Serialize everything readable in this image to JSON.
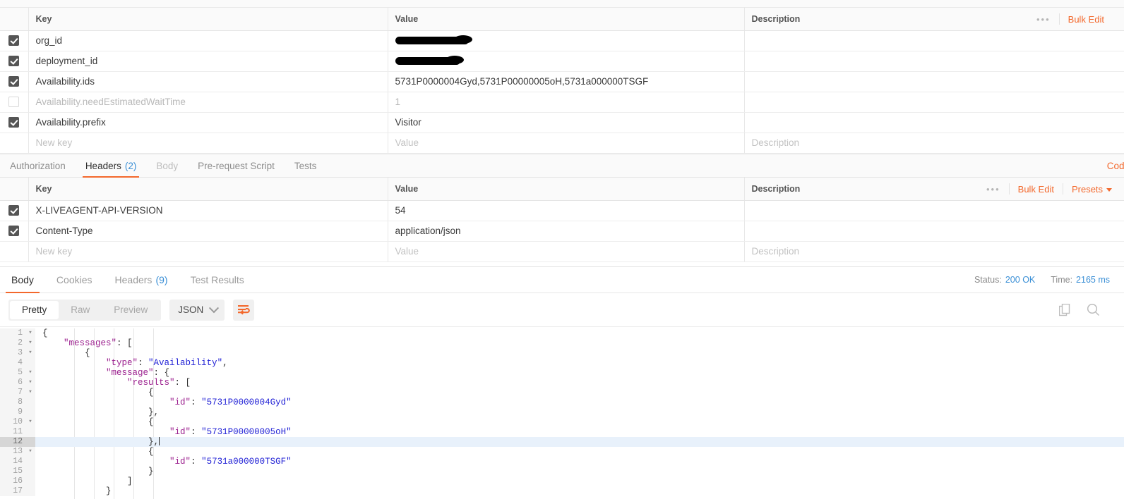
{
  "params_table": {
    "columns": [
      "Key",
      "Value",
      "Description"
    ],
    "actions": {
      "dots": "•••",
      "bulk_edit": "Bulk Edit"
    },
    "rows": [
      {
        "checked": true,
        "key": "org_id",
        "value": "",
        "redacted": true,
        "redact_width": 104,
        "description": ""
      },
      {
        "checked": true,
        "key": "deployment_id",
        "value": "",
        "redacted": true,
        "redact_width": 92,
        "description": ""
      },
      {
        "checked": true,
        "key": "Availability.ids",
        "value": "5731P0000004Gyd,5731P00000005oH,5731a000000TSGF",
        "redacted": false,
        "description": ""
      },
      {
        "checked": false,
        "key": "Availability.needEstimatedWaitTime",
        "value": "1",
        "redacted": false,
        "description": ""
      },
      {
        "checked": true,
        "key": "Availability.prefix",
        "value": "Visitor",
        "redacted": false,
        "description": ""
      }
    ],
    "placeholder_row": {
      "key": "New key",
      "value": "Value",
      "description": "Description"
    }
  },
  "request_tabs": {
    "items": [
      {
        "label": "Authorization",
        "count": "",
        "active": false,
        "muted": false
      },
      {
        "label": "Headers",
        "count": "(2)",
        "active": true,
        "muted": false
      },
      {
        "label": "Body",
        "count": "",
        "active": false,
        "muted": true
      },
      {
        "label": "Pre-request Script",
        "count": "",
        "active": false,
        "muted": false
      },
      {
        "label": "Tests",
        "count": "",
        "active": false,
        "muted": false
      }
    ],
    "code_link": "Code"
  },
  "headers_table": {
    "columns": [
      "Key",
      "Value",
      "Description"
    ],
    "actions": {
      "dots": "•••",
      "bulk_edit": "Bulk Edit",
      "presets": "Presets"
    },
    "rows": [
      {
        "checked": true,
        "key": "X-LIVEAGENT-API-VERSION",
        "value": "54",
        "description": ""
      },
      {
        "checked": true,
        "key": "Content-Type",
        "value": "application/json",
        "description": ""
      }
    ],
    "placeholder_row": {
      "key": "New key",
      "value": "Value",
      "description": "Description"
    }
  },
  "response": {
    "tabs": [
      {
        "label": "Body",
        "count": "",
        "active": true
      },
      {
        "label": "Cookies",
        "count": "",
        "active": false
      },
      {
        "label": "Headers",
        "count": "(9)",
        "active": false
      },
      {
        "label": "Test Results",
        "count": "",
        "active": false
      }
    ],
    "status_label": "Status:",
    "status_value": "200 OK",
    "time_label": "Time:",
    "time_value": "2165 ms",
    "toolbar": {
      "views": [
        {
          "label": "Pretty",
          "selected": true
        },
        {
          "label": "Raw",
          "selected": false
        },
        {
          "label": "Preview",
          "selected": false
        }
      ],
      "format": "JSON",
      "wrap_icon": "word-wrap-icon",
      "copy_icon": "copy-icon",
      "search_icon": "search-icon"
    },
    "body_lines": [
      {
        "n": 1,
        "fold": true,
        "active": false,
        "indent": 0,
        "tokens": [
          {
            "t": "pun",
            "v": "{"
          }
        ]
      },
      {
        "n": 2,
        "fold": true,
        "active": false,
        "indent": 1,
        "tokens": [
          {
            "t": "key",
            "v": "\"messages\""
          },
          {
            "t": "pun",
            "v": ": ["
          }
        ]
      },
      {
        "n": 3,
        "fold": true,
        "active": false,
        "indent": 2,
        "tokens": [
          {
            "t": "pun",
            "v": "{"
          }
        ]
      },
      {
        "n": 4,
        "fold": false,
        "active": false,
        "indent": 3,
        "tokens": [
          {
            "t": "key",
            "v": "\"type\""
          },
          {
            "t": "pun",
            "v": ": "
          },
          {
            "t": "str",
            "v": "\"Availability\""
          },
          {
            "t": "pun",
            "v": ","
          }
        ]
      },
      {
        "n": 5,
        "fold": true,
        "active": false,
        "indent": 3,
        "tokens": [
          {
            "t": "key",
            "v": "\"message\""
          },
          {
            "t": "pun",
            "v": ": {"
          }
        ]
      },
      {
        "n": 6,
        "fold": true,
        "active": false,
        "indent": 4,
        "tokens": [
          {
            "t": "key",
            "v": "\"results\""
          },
          {
            "t": "pun",
            "v": ": ["
          }
        ]
      },
      {
        "n": 7,
        "fold": true,
        "active": false,
        "indent": 5,
        "tokens": [
          {
            "t": "pun",
            "v": "{"
          }
        ]
      },
      {
        "n": 8,
        "fold": false,
        "active": false,
        "indent": 6,
        "tokens": [
          {
            "t": "key",
            "v": "\"id\""
          },
          {
            "t": "pun",
            "v": ": "
          },
          {
            "t": "str",
            "v": "\"5731P0000004Gyd\""
          }
        ]
      },
      {
        "n": 9,
        "fold": false,
        "active": false,
        "indent": 5,
        "tokens": [
          {
            "t": "pun",
            "v": "},"
          }
        ]
      },
      {
        "n": 10,
        "fold": true,
        "active": false,
        "indent": 5,
        "tokens": [
          {
            "t": "pun",
            "v": "{"
          }
        ]
      },
      {
        "n": 11,
        "fold": false,
        "active": false,
        "indent": 6,
        "tokens": [
          {
            "t": "key",
            "v": "\"id\""
          },
          {
            "t": "pun",
            "v": ": "
          },
          {
            "t": "str",
            "v": "\"5731P00000005oH\""
          }
        ]
      },
      {
        "n": 12,
        "fold": false,
        "active": true,
        "indent": 5,
        "tokens": [
          {
            "t": "pun",
            "v": "},"
          }
        ],
        "caret": true
      },
      {
        "n": 13,
        "fold": true,
        "active": false,
        "indent": 5,
        "tokens": [
          {
            "t": "pun",
            "v": "{"
          }
        ]
      },
      {
        "n": 14,
        "fold": false,
        "active": false,
        "indent": 6,
        "tokens": [
          {
            "t": "key",
            "v": "\"id\""
          },
          {
            "t": "pun",
            "v": ": "
          },
          {
            "t": "str",
            "v": "\"5731a000000TSGF\""
          }
        ]
      },
      {
        "n": 15,
        "fold": false,
        "active": false,
        "indent": 5,
        "tokens": [
          {
            "t": "pun",
            "v": "}"
          }
        ]
      },
      {
        "n": 16,
        "fold": false,
        "active": false,
        "indent": 4,
        "tokens": [
          {
            "t": "pun",
            "v": "]"
          }
        ]
      },
      {
        "n": 17,
        "fold": false,
        "active": false,
        "indent": 3,
        "tokens": [
          {
            "t": "pun",
            "v": "}"
          }
        ]
      }
    ]
  },
  "colors": {
    "accent": "#f3682c",
    "link": "#3a8fd6",
    "json_key": "#9b1f8e",
    "json_string": "#2323d6",
    "active_line": "#e8f1fb"
  }
}
